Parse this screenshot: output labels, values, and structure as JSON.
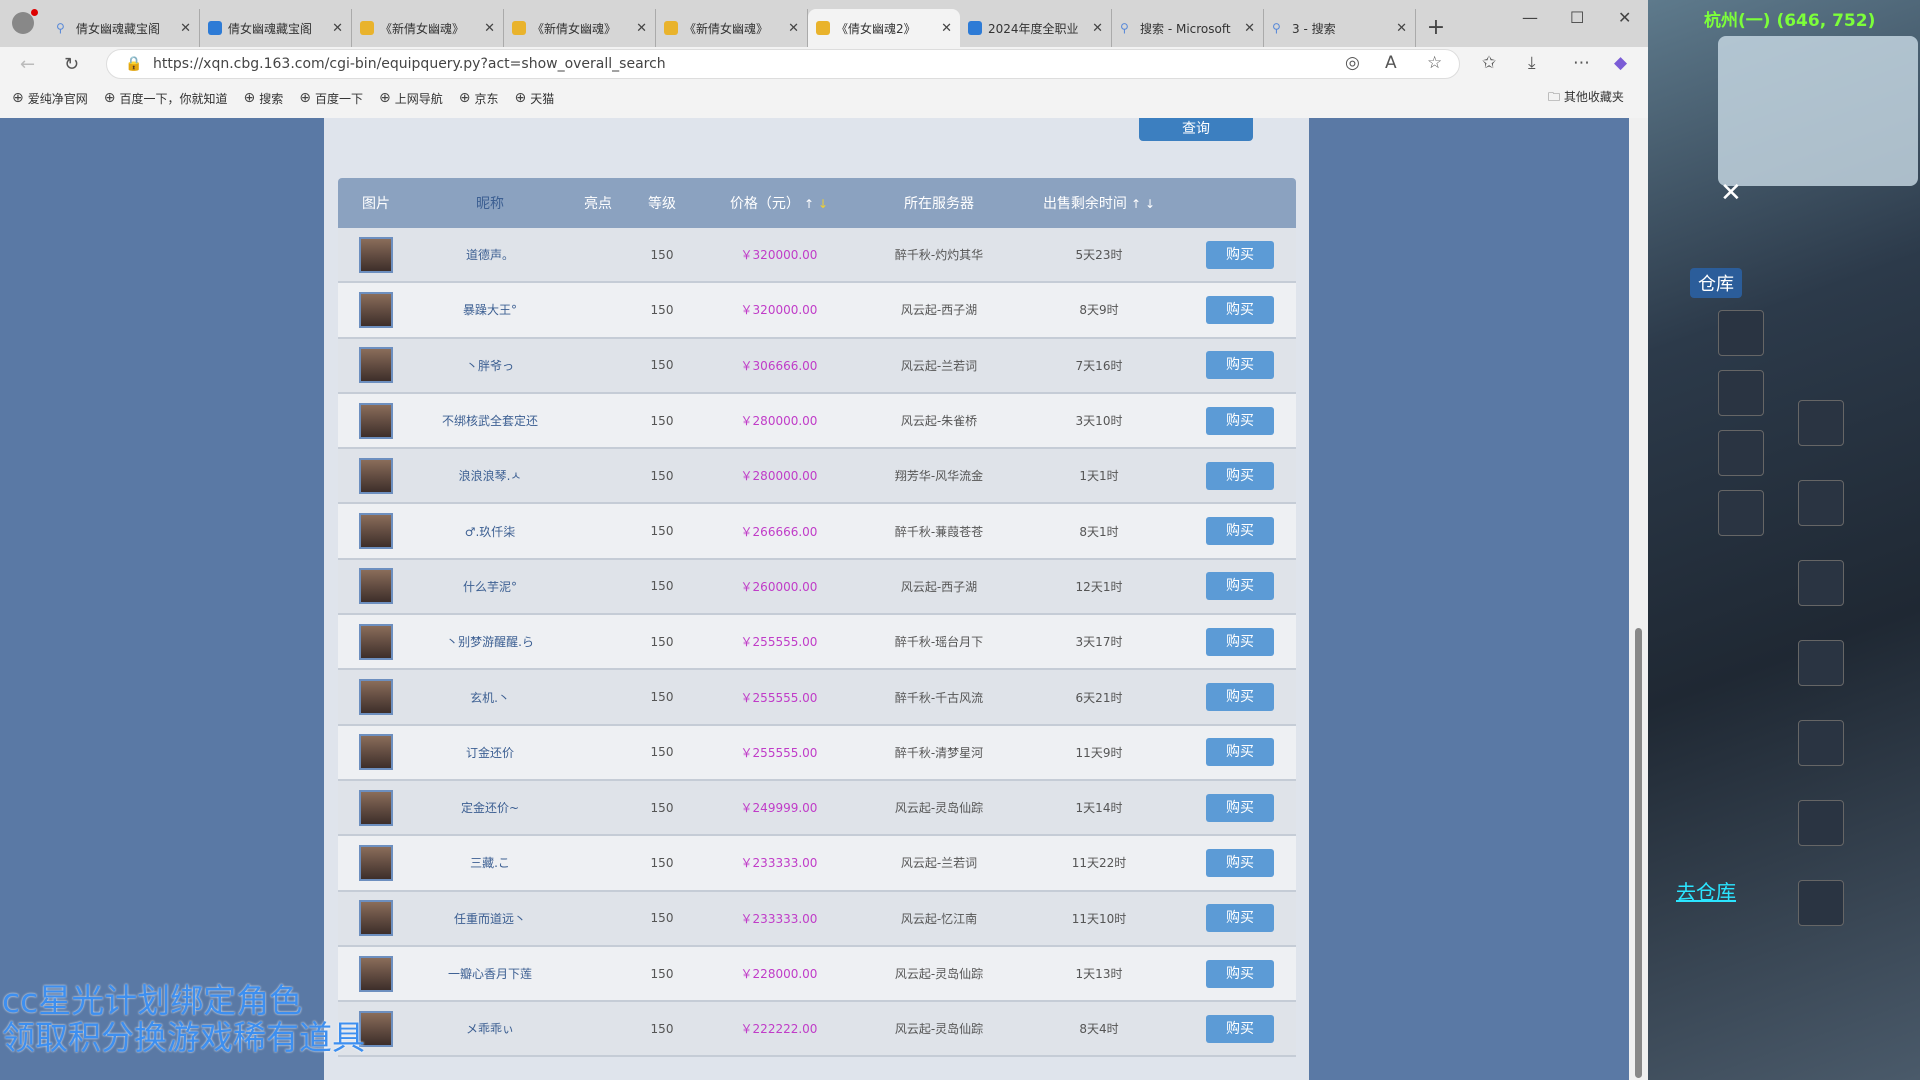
{
  "browser": {
    "tabs": [
      {
        "title": "倩女幽魂藏宝阁",
        "icon": "search"
      },
      {
        "title": "倩女幽魂藏宝阁",
        "icon": "app"
      },
      {
        "title": "《新倩女幽魂》",
        "icon": "game"
      },
      {
        "title": "《新倩女幽魂》",
        "icon": "game"
      },
      {
        "title": "《新倩女幽魂》",
        "icon": "game"
      },
      {
        "title": "《倩女幽魂2》",
        "icon": "game",
        "active": true
      },
      {
        "title": "2024年度全职业",
        "icon": "app"
      },
      {
        "title": "搜索 - Microsoft",
        "icon": "search"
      },
      {
        "title": "3 - 搜索",
        "icon": "search"
      }
    ],
    "url": "https://xqn.cbg.163.com/cgi-bin/equipquery.py?act=show_overall_search",
    "bookmarks": [
      "爱纯净官网",
      "百度一下，你就知道",
      "搜索",
      "百度一下",
      "上网导航",
      "京东",
      "天猫"
    ],
    "other_bookmarks": "其他收藏夹"
  },
  "page": {
    "query_button": "查询",
    "headers": [
      "图片",
      "昵称",
      "亮点",
      "等级",
      "价格（元）",
      "所在服务器",
      "出售剩余时间"
    ],
    "sort_up": "↑",
    "sort_down": "↓",
    "accent_price": "#c03cc8",
    "rows": [
      {
        "name": "道德声。",
        "level": "150",
        "price": "￥320000.00",
        "server": "醉千秋-灼灼其华",
        "time": "5天23时",
        "buy": "购买"
      },
      {
        "name": "暴躁大王°",
        "level": "150",
        "price": "￥320000.00",
        "server": "风云起-西子湖",
        "time": "8天9时",
        "buy": "购买"
      },
      {
        "name": "丶胖爷っ",
        "level": "150",
        "price": "￥306666.00",
        "server": "风云起-兰若词",
        "time": "7天16时",
        "buy": "购买"
      },
      {
        "name": "不绑核武全套定还",
        "level": "150",
        "price": "￥280000.00",
        "server": "风云起-朱雀桥",
        "time": "3天10时",
        "buy": "购买"
      },
      {
        "name": "浪浪浪琴.ㅅ",
        "level": "150",
        "price": "￥280000.00",
        "server": "翔芳华-风华流金",
        "time": "1天1时",
        "buy": "购买"
      },
      {
        "name": "♂.玖仟柒",
        "level": "150",
        "price": "￥266666.00",
        "server": "醉千秋-蒹葭苍苍",
        "time": "8天1时",
        "buy": "购买"
      },
      {
        "name": "什么芋泥°",
        "level": "150",
        "price": "￥260000.00",
        "server": "风云起-西子湖",
        "time": "12天1时",
        "buy": "购买"
      },
      {
        "name": "丶别梦游醒醒.ら",
        "level": "150",
        "price": "￥255555.00",
        "server": "醉千秋-瑶台月下",
        "time": "3天17时",
        "buy": "购买"
      },
      {
        "name": "玄机.丶",
        "level": "150",
        "price": "￥255555.00",
        "server": "醉千秋-千古风流",
        "time": "6天21时",
        "buy": "购买"
      },
      {
        "name": "订金还价",
        "level": "150",
        "price": "￥255555.00",
        "server": "醉千秋-清梦星河",
        "time": "11天9时",
        "buy": "购买"
      },
      {
        "name": "定金还价~",
        "level": "150",
        "price": "￥249999.00",
        "server": "风云起-灵岛仙踪",
        "time": "1天14时",
        "buy": "购买"
      },
      {
        "name": "三藏.こ",
        "level": "150",
        "price": "￥233333.00",
        "server": "风云起-兰若词",
        "time": "11天22时",
        "buy": "购买"
      },
      {
        "name": "任重而道远丶",
        "level": "150",
        "price": "￥233333.00",
        "server": "风云起-忆江南",
        "time": "11天10时",
        "buy": "购买"
      },
      {
        "name": "一瓣心香月下莲",
        "level": "150",
        "price": "￥228000.00",
        "server": "风云起-灵岛仙踪",
        "time": "1天13时",
        "buy": "购买"
      },
      {
        "name": "メ乖乖ぃ",
        "level": "150",
        "price": "￥222222.00",
        "server": "风云起-灵岛仙踪",
        "time": "8天4时",
        "buy": "购买"
      }
    ]
  },
  "game": {
    "location": "杭州(一) (646, 752)",
    "warehouse": "仓库",
    "go_warehouse": "去仓库"
  },
  "overlay": {
    "line1": "cc星光计划绑定角色",
    "line2": "领取积分换游戏稀有道具"
  }
}
